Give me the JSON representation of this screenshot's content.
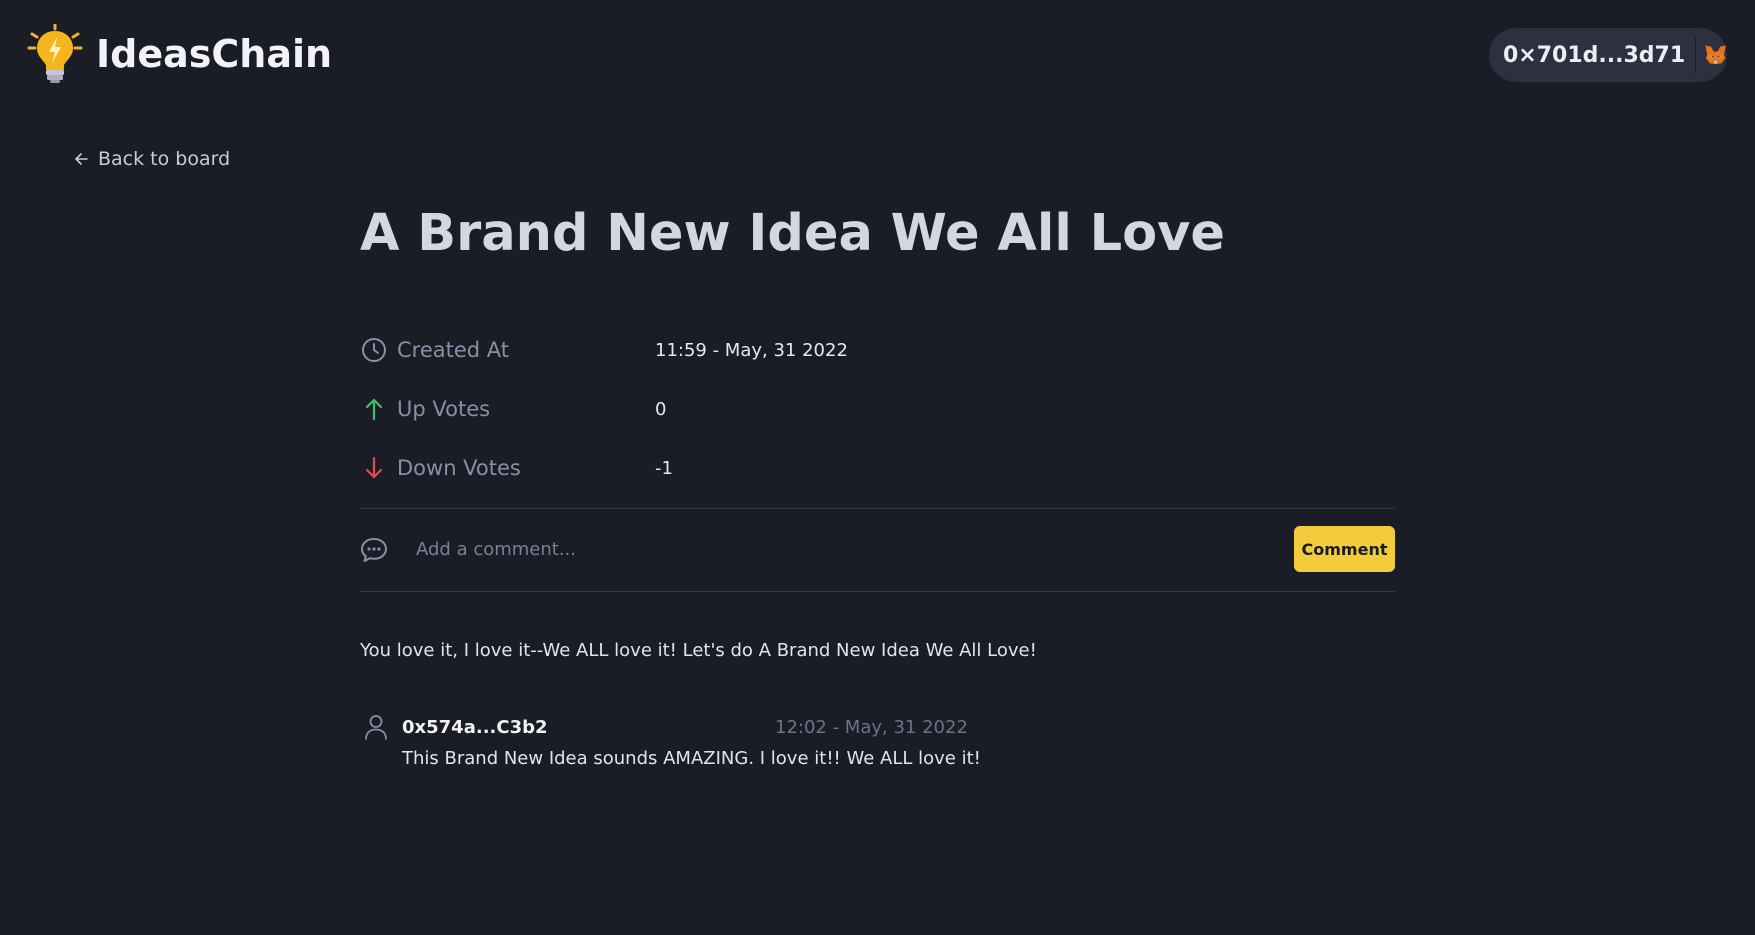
{
  "header": {
    "app_name": "IdeasChain",
    "wallet_address": "0×701d...3d71",
    "logo_icon": "lightbulb-icon",
    "wallet_icon": "metamask-fox-icon"
  },
  "nav": {
    "back_label": "Back to board"
  },
  "idea": {
    "title": "A Brand New Idea We All Love",
    "meta": [
      {
        "icon": "clock-icon",
        "label": "Created At",
        "value": "11:59 - May, 31 2022"
      },
      {
        "icon": "arrow-up-icon",
        "label": "Up Votes",
        "value": "0"
      },
      {
        "icon": "arrow-down-icon",
        "label": "Down Votes",
        "value": "-1"
      }
    ],
    "description": "You love it, I love it--We ALL love it! Let's do A Brand New Idea We All Love!"
  },
  "comment_form": {
    "placeholder": "Add a comment...",
    "button_label": "Comment"
  },
  "comments": [
    {
      "author": "0x574a...C3b2",
      "time": "12:02 - May, 31 2022",
      "text": "This Brand New Idea sounds AMAZING. I love it!! We ALL love it!"
    }
  ],
  "colors": {
    "background": "#1a1c26",
    "accent": "#f2cc3d",
    "up_vote": "#3fbf6b",
    "down_vote": "#e5484d",
    "wallet_pill": "#2d3040"
  }
}
